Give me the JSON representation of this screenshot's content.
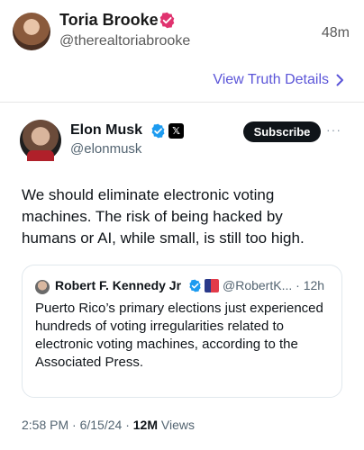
{
  "truth": {
    "author_name": "Toria Brooke",
    "author_handle": "@therealtoriabrooke",
    "time_ago": "48m",
    "view_details": "View Truth Details"
  },
  "x_post": {
    "author_name": "Elon Musk",
    "author_handle": "@elonmusk",
    "affiliate_badge": "𝕏",
    "subscribe_label": "Subscribe",
    "more": "···",
    "body": "We should eliminate electronic voting machines. The risk of being hacked by humans or AI, while small, is still too high.",
    "quote": {
      "author_name": "Robert F. Kennedy Jr",
      "author_handle": "@RobertK...",
      "time": "12h",
      "body": "Puerto Rico’s primary elections just experienced hundreds of voting irregularities related to electronic voting machines, according to the Associated Press."
    },
    "footer": {
      "time": "2:58 PM",
      "date": "6/15/24",
      "views_count": "12M",
      "views_label": "Views"
    }
  },
  "colors": {
    "link_purple": "#5b55d8",
    "verified_pink": "#e0336f",
    "verified_blue": "#1d9bf0"
  }
}
